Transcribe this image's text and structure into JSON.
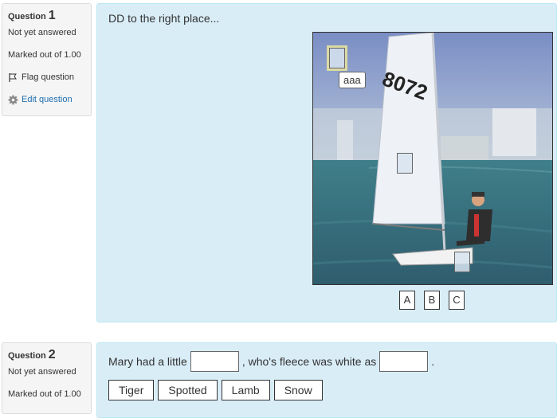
{
  "question1": {
    "label": "Question",
    "number": "1",
    "status": "Not yet answered",
    "marks": "Marked out of 1.00",
    "flag_label": "Flag question",
    "edit_label": "Edit question",
    "text": "DD to the right place...",
    "sail_text": "8072",
    "tooltip": "aaa",
    "choices": [
      "A",
      "B",
      "C"
    ]
  },
  "question2": {
    "label": "Question",
    "number": "2",
    "status": "Not yet answered",
    "marks": "Marked out of 1.00",
    "text_part1": "Mary had a little",
    "text_part2": ", who's fleece was white as",
    "text_part3": ".",
    "choices": [
      "Tiger",
      "Spotted",
      "Lamb",
      "Snow"
    ]
  },
  "colors": {
    "content_bg": "#d9edf7",
    "info_bg": "#f5f5f5",
    "link": "#1f6fb0"
  },
  "icons": [
    "flag-icon",
    "gear-icon"
  ]
}
